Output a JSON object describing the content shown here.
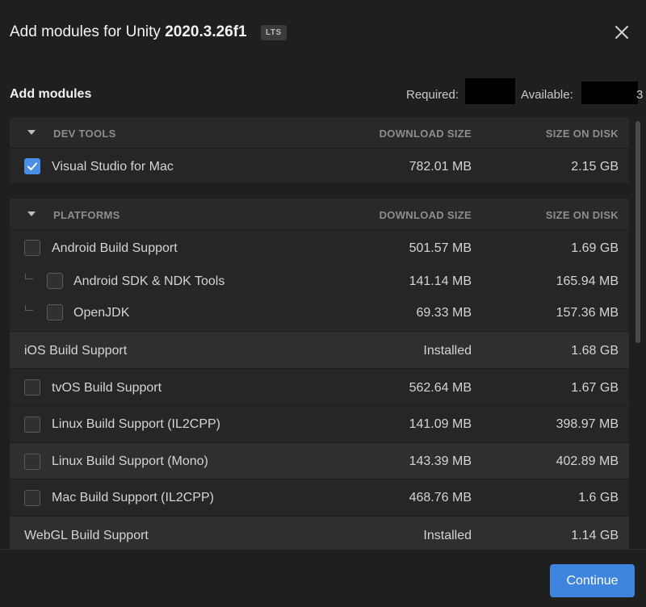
{
  "header": {
    "title_prefix": "Add modules for Unity ",
    "version": "2020.3.26f1",
    "badge": "LTS",
    "close_icon": "close-icon"
  },
  "subheader": {
    "title": "Add modules",
    "required_label": "Required:",
    "available_label": "Available:",
    "available_tail": "3"
  },
  "columns": {
    "download_size": "DOWNLOAD SIZE",
    "size_on_disk": "SIZE ON DISK"
  },
  "sections": [
    {
      "name": "DEV TOOLS",
      "rows": [
        {
          "name": "Visual Studio for Mac",
          "download": "782.01 MB",
          "disk": "2.15 GB",
          "checked": true
        }
      ]
    },
    {
      "name": "PLATFORMS",
      "rows": [
        {
          "name": "Android Build Support",
          "download": "501.57 MB",
          "disk": "1.69 GB",
          "checked": false
        },
        {
          "name": "Android SDK & NDK Tools",
          "download": "141.14 MB",
          "disk": "165.94 MB",
          "checked": false
        },
        {
          "name": "OpenJDK",
          "download": "69.33 MB",
          "disk": "157.36 MB",
          "checked": false
        },
        {
          "name": "iOS Build Support",
          "download": "Installed",
          "disk": "1.68 GB"
        },
        {
          "name": "tvOS Build Support",
          "download": "562.64 MB",
          "disk": "1.67 GB",
          "checked": false
        },
        {
          "name": "Linux Build Support (IL2CPP)",
          "download": "141.09 MB",
          "disk": "398.97 MB",
          "checked": false
        },
        {
          "name": "Linux Build Support (Mono)",
          "download": "143.39 MB",
          "disk": "402.89 MB",
          "checked": false
        },
        {
          "name": "Mac Build Support (IL2CPP)",
          "download": "468.76 MB",
          "disk": "1.6 GB",
          "checked": false
        },
        {
          "name": "WebGL Build Support",
          "download": "Installed",
          "disk": "1.14 GB"
        }
      ]
    }
  ],
  "footer": {
    "continue_label": "Continue"
  },
  "colors": {
    "accent": "#3f84dd",
    "background": "#1f1f1f",
    "panel": "#292929"
  }
}
